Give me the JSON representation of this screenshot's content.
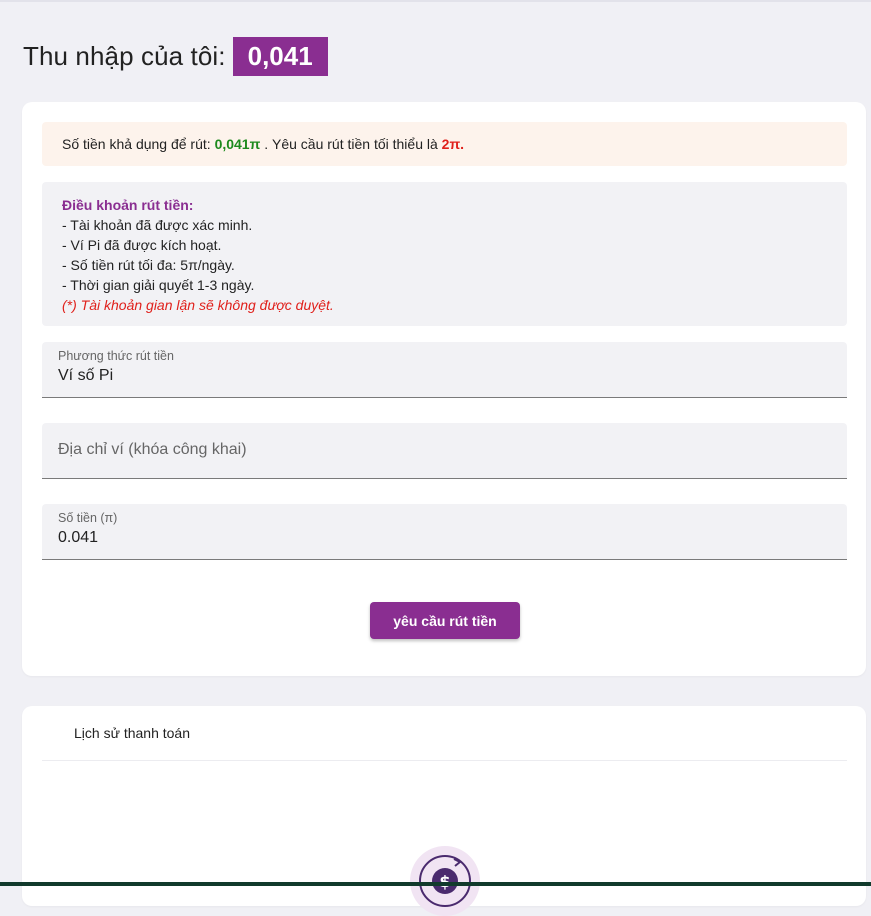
{
  "header": {
    "title": "Thu nhập của tôi:",
    "amount": "0,041"
  },
  "notice": {
    "prefix": "Số tiền khả dụng để rút: ",
    "available": "0,041π",
    "middle": " . Yêu cầu rút tiền tối thiểu là ",
    "minimum": "2π."
  },
  "terms": {
    "title": "Điều khoản rút tiền:",
    "lines": [
      "- Tài khoản đã được xác minh.",
      "- Ví Pi đã được kích hoạt.",
      "- Số tiền rút tối đa: 5π/ngày.",
      "- Thời gian giải quyết 1-3 ngày."
    ],
    "warning": "(*) Tài khoản gian lận sẽ không được duyệt."
  },
  "form": {
    "method_label": "Phương thức rút tiền",
    "method_value": "Ví số Pi",
    "wallet_placeholder": "Địa chỉ ví (khóa công khai)",
    "amount_label": "Số tiền (π)",
    "amount_value": "0.041",
    "submit_label": "yêu cầu rút tiền"
  },
  "history": {
    "title": "Lịch sử thanh toán",
    "empty_icon": "money-refresh-icon"
  },
  "colors": {
    "brand": "#8a2e91",
    "available": "#1d8a1d",
    "minimum": "#e0201b",
    "notice_bg": "#fdf3ec"
  }
}
